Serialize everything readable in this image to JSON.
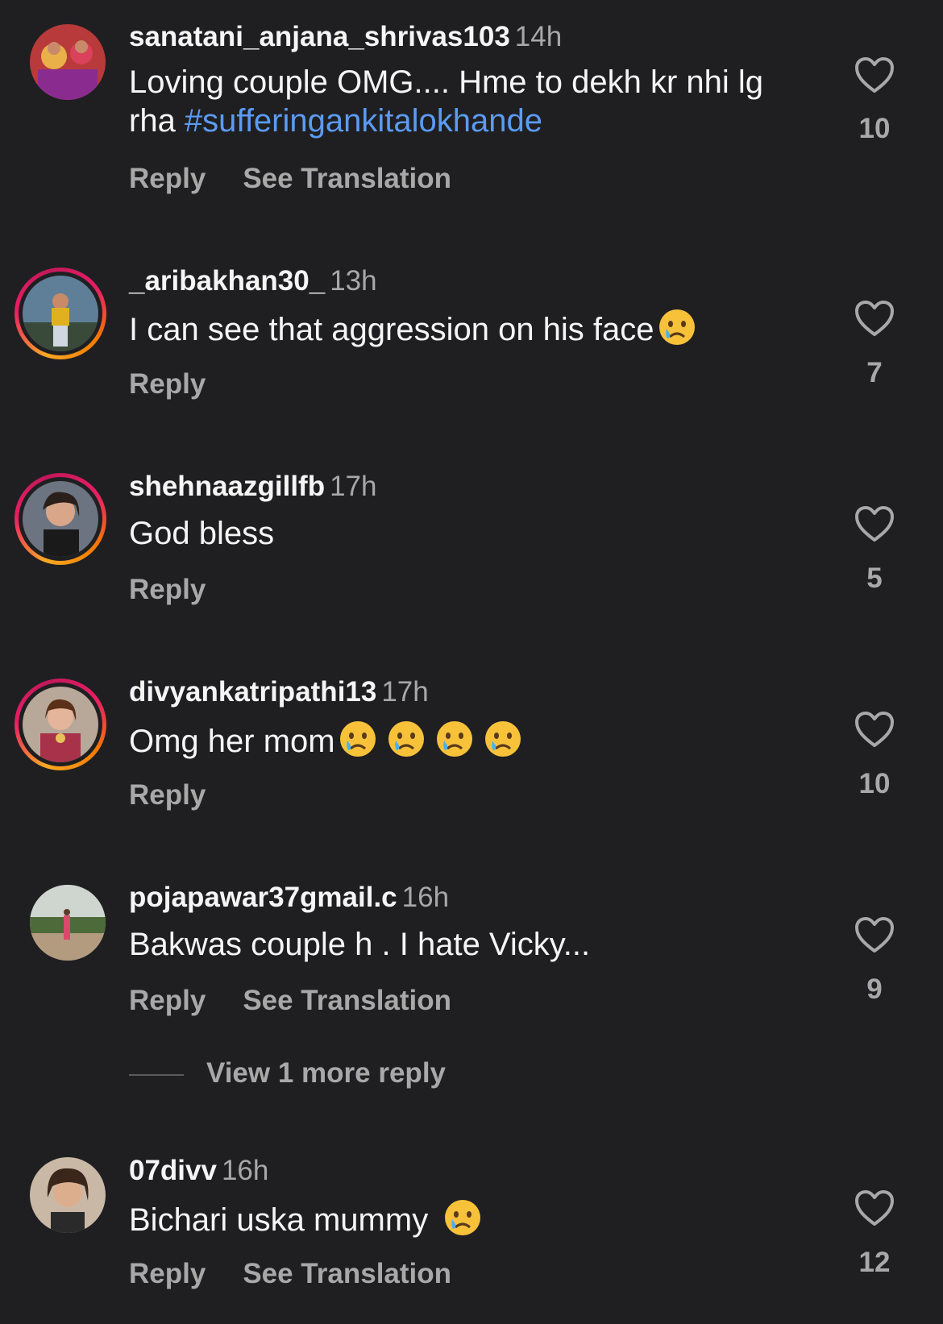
{
  "comments": [
    {
      "username": "sanatani_anjana_shrivas103",
      "time": "14h",
      "text": "Loving couple OMG.... Hme to dekh kr nhi lg rha ",
      "hashtag": "#sufferingankitalokhande",
      "reply_label": "Reply",
      "translate_label": "See Translation",
      "likes": "10"
    },
    {
      "username": "_aribakhan30_",
      "time": "13h",
      "text": "I can see that aggression on his face",
      "emoji": "crying-face",
      "reply_label": "Reply",
      "likes": "7"
    },
    {
      "username": "shehnaazgillfb",
      "time": "17h",
      "text": "God bless",
      "reply_label": "Reply",
      "likes": "5"
    },
    {
      "username": "divyankatripathi13",
      "time": "17h",
      "text": "Omg her mom",
      "emoji": "crying-face",
      "emoji_count": 4,
      "reply_label": "Reply",
      "likes": "10"
    },
    {
      "username": "pojapawar37gmail.c",
      "time": "16h",
      "text": "Bakwas couple h . I hate Vicky...",
      "reply_label": "Reply",
      "translate_label": "See Translation",
      "likes": "9"
    },
    {
      "username": "07divv",
      "time": "16h",
      "text": "Bichari uska mummy ",
      "emoji": "crying-face",
      "reply_label": "Reply",
      "translate_label": "See Translation",
      "likes": "12"
    }
  ],
  "view_more_replies": "View 1 more reply",
  "colors": {
    "background": "#1f1f21",
    "text": "#f5f5f5",
    "secondary": "#a8a8a8",
    "hashtag": "#5b9bf3",
    "story_ring_start": "#f9a825",
    "story_ring_end": "#e91e63"
  },
  "icons": {
    "like": "heart-outline-icon",
    "emoji": "crying-face-emoji"
  }
}
